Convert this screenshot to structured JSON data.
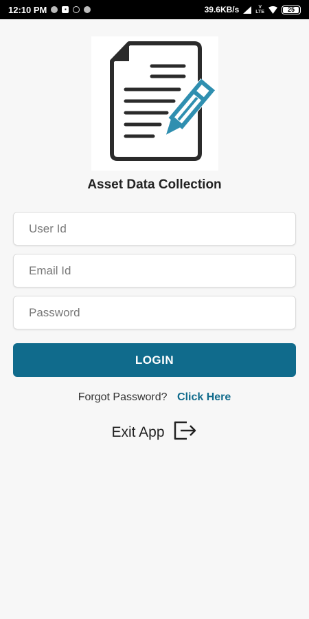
{
  "status_bar": {
    "time": "12:10 PM",
    "network_speed": "39.6KB/s",
    "battery_level": "25",
    "icons": [
      "notification-dot-icon",
      "app-icon",
      "whatsapp-icon",
      "notification-dot-icon",
      "signal-icon",
      "volte-icon",
      "wifi-icon",
      "battery-icon"
    ]
  },
  "app": {
    "title": "Asset Data Collection",
    "logo": "document-with-pencil-icon"
  },
  "form": {
    "user_id_placeholder": "User Id",
    "email_placeholder": "Email Id",
    "password_placeholder": "Password",
    "login_label": "LOGIN"
  },
  "forgot": {
    "text": "Forgot Password?",
    "link": "Click Here"
  },
  "exit": {
    "label": "Exit App",
    "icon": "exit-icon"
  },
  "colors": {
    "primary": "#106b8c",
    "logo_accent": "#2f8fb0",
    "background": "#f7f7f7"
  }
}
